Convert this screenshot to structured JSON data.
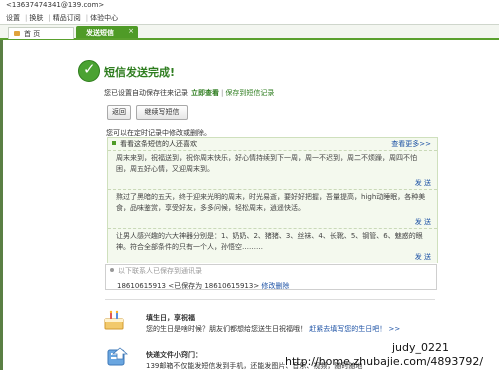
{
  "header": {
    "account": "<13637474341@139.com>",
    "nav": [
      "设置",
      "换肤",
      "精品订阅",
      "体验中心"
    ]
  },
  "tabs": [
    {
      "label": "首 页"
    },
    {
      "label": "发送短信",
      "close": "×"
    }
  ],
  "success": {
    "title": "短信发送完成!",
    "saved_note_prefix": "您已设置自动保存往来记录",
    "view_link": "立即查看",
    "save_draft_link": "保存到短信记录"
  },
  "buttons": {
    "back": "返回",
    "continue": "继续写短信"
  },
  "edit_note": "您可以在定时记录中修改或删除。",
  "panel": {
    "title": "看看这条短信的人还喜欢",
    "more": "查看更多>>",
    "send_label": "发 送",
    "messages": [
      "周末来到，祝福送到，祝你周末快乐，好心情持续到下一周，周一不迟到，周二不烦躁，周四不怕困，周五好心情，又迎周末到。",
      "熬过了黑暗的五天，终于迎来光明的周末，时光易逝，要好好把握，吾量提高，high动睡眠，各种美食，品味鉴赏，享受好友，多多问候，轻松周末，逍遥快活。",
      "让男人感兴趣的六大神器分别是：1、奶奶、2、猪猪、3、丝袜、4、长靴、5、钢管、6、魅惑的眼神。符合全部条件的只有一个人，孙悟空………"
    ]
  },
  "saved": {
    "hint": "以下联系人已保存到通讯录",
    "number": "18610615913",
    "saved_as": "<已保存为 18610615913>",
    "edit_link": "修改删除"
  },
  "birthday": {
    "title": "填生日，享祝福",
    "text": "您的生日是啥时候？朋友们都想给您送生日祝福哦！",
    "link": "赶紧去填写您的生日吧！",
    "arrow": ">>"
  },
  "transfer": {
    "title": "快递文件小窍门：",
    "text": "139邮箱不仅能发短信发到手机，还能发图片、音乐、视频，随时随地"
  },
  "watermark": {
    "user": "judy_0221",
    "url": "http://home.zhubajie.com/4893792/"
  }
}
